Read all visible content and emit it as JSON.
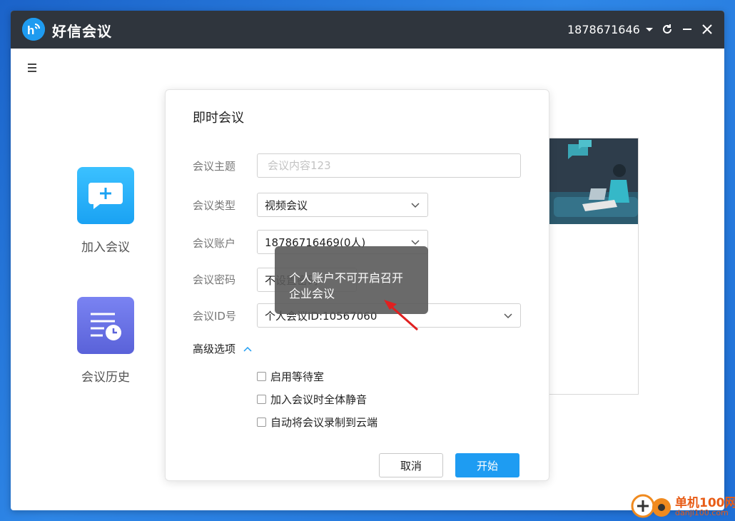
{
  "app": {
    "title": "好信会议",
    "account": "1878671646",
    "colors": {
      "titlebar": "#2f353d",
      "accent": "#1e9cf2"
    }
  },
  "sidebar": {
    "join_label": "加入会议",
    "history_label": "会议历史"
  },
  "dialog": {
    "title": "即时会议",
    "topic": {
      "label": "会议主题",
      "placeholder": "会议内容123",
      "value": ""
    },
    "type": {
      "label": "会议类型",
      "value": "视频会议"
    },
    "account": {
      "label": "会议账户",
      "value": "18786716469(0人)"
    },
    "password": {
      "label": "会议密码",
      "value": "不设置密码"
    },
    "meeting_id": {
      "label": "会议ID号",
      "value": "个人会议ID:10567060"
    },
    "advanced": {
      "label": "高级选项"
    },
    "options": [
      {
        "label": "启用等待室",
        "checked": false
      },
      {
        "label": "加入会议时全体静音",
        "checked": false
      },
      {
        "label": "自动将会议录制到云端",
        "checked": false
      }
    ],
    "cancel_label": "取消",
    "start_label": "开始"
  },
  "tooltip": {
    "line1": "个人账户不可开启召开",
    "line2": "企业会议"
  },
  "watermark": {
    "name": "单机100网",
    "domain": "danji100.com"
  }
}
